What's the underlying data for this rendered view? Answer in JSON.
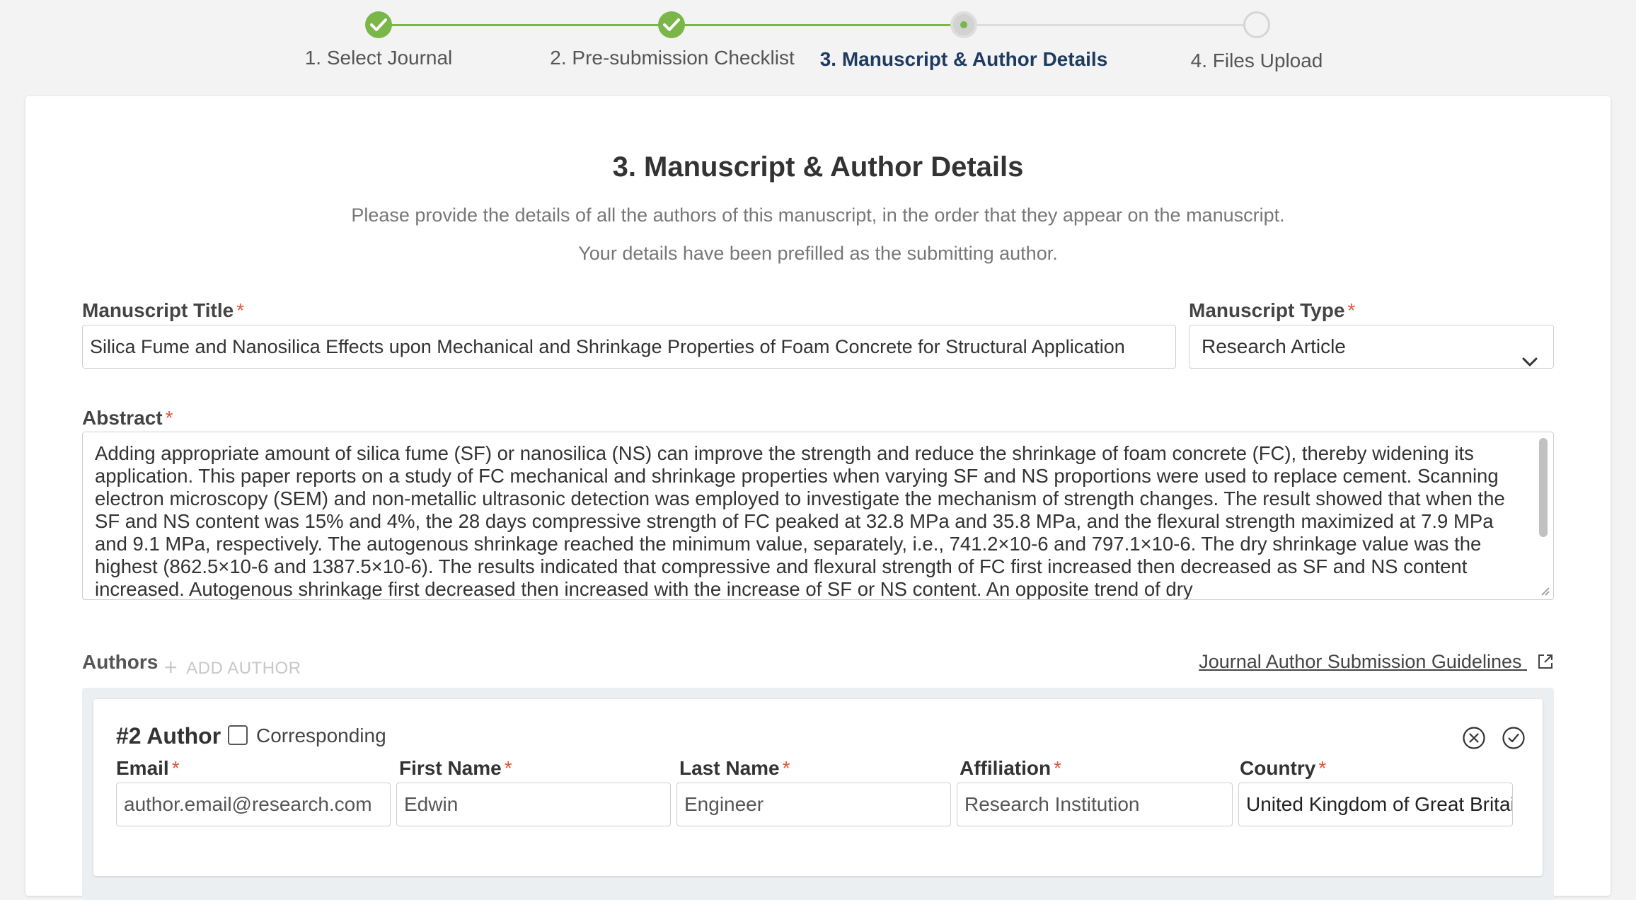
{
  "stepper": {
    "steps": [
      {
        "label": "1. Select Journal",
        "status": "done"
      },
      {
        "label": "2. Pre-submission Checklist",
        "status": "done"
      },
      {
        "label": "3. Manuscript & Author Details",
        "status": "current"
      },
      {
        "label": "4. Files Upload",
        "status": "pending"
      }
    ]
  },
  "header": {
    "title": "3. Manuscript & Author Details",
    "subtitle1": "Please provide the details of all the authors of this manuscript, in the order that they appear on the manuscript.",
    "subtitle2": "Your details have been prefilled as the submitting author."
  },
  "form": {
    "title_label": "Manuscript Title",
    "title_value": "Silica Fume and Nanosilica Effects upon Mechanical and Shrinkage Properties of Foam Concrete for Structural Application",
    "type_label": "Manuscript Type",
    "type_value": "Research Article",
    "abstract_label": "Abstract",
    "abstract_value": "Adding appropriate amount of silica fume (SF) or nanosilica (NS) can improve the strength and reduce the shrinkage of foam concrete (FC), thereby widening its application. This paper reports on a study of FC mechanical and shrinkage properties when varying SF and NS proportions were used to replace cement. Scanning electron microscopy (SEM) and non-metallic ultrasonic detection was employed to investigate the mechanism of strength changes. The result showed that when the SF and NS content was 15% and 4%, the 28 days compressive strength of FC peaked at 32.8 MPa and 35.8 MPa, and the flexural strength maximized at 7.9 MPa and 9.1 MPa, respectively. The autogenous shrinkage reached the minimum value, separately, i.e., 741.2×10-6 and 797.1×10-6. The dry shrinkage value was the highest (862.5×10-6 and 1387.5×10-6). The results indicated that compressive and flexural strength of FC first increased then decreased as SF and NS content increased. Autogenous shrinkage first decreased then increased with the increase of SF or NS content. An opposite trend of dry",
    "required_mark": "*"
  },
  "authors": {
    "label": "Authors",
    "add_label": "ADD AUTHOR",
    "add_icon": "+",
    "guidelines_link": "Journal Author Submission Guidelines",
    "card": {
      "heading": "#2 Author",
      "corresponding_label": "Corresponding",
      "email_label": "Email",
      "email_value": "author.email@research.com",
      "first_name_label": "First Name",
      "first_name_value": "Edwin",
      "last_name_label": "Last Name",
      "last_name_value": "Engineer",
      "affiliation_label": "Affiliation",
      "affiliation_value": "Research Institution",
      "country_label": "Country",
      "country_value": "United Kingdom of Great Britain"
    }
  },
  "colors": {
    "accent_green": "#7ab648",
    "required_red": "#e2563b",
    "current_step_text": "#1e3a5f"
  }
}
